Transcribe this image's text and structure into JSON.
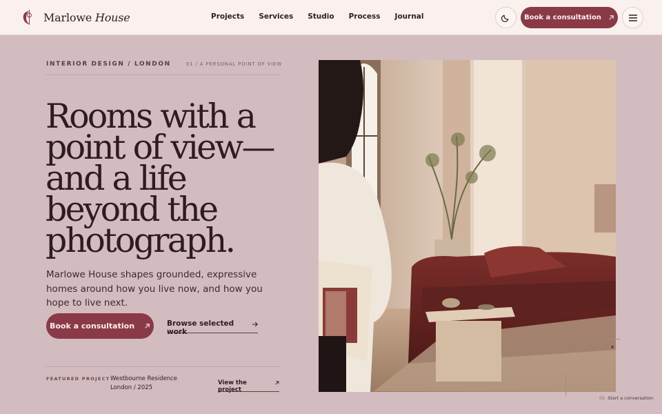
{
  "brand": {
    "name_first": "Marlowe",
    "name_second": "House"
  },
  "nav": {
    "items": [
      {
        "label": "Projects"
      },
      {
        "label": "Services"
      },
      {
        "label": "Studio"
      },
      {
        "label": "Process"
      },
      {
        "label": "Journal"
      }
    ]
  },
  "header": {
    "book_label": "Book a consultation",
    "theme_icon": "moon-icon",
    "menu_icon": "hamburger-icon"
  },
  "hero": {
    "eyebrow": "INTERIOR DESIGN / LONDON",
    "index_label": "01 / A PERSONAL POINT OF VIEW",
    "headline_lines": [
      "Rooms with a",
      "point of view—",
      "and a life",
      "beyond the",
      "photograph."
    ],
    "subtext": "Marlowe House shapes grounded, expressive homes around how you live now, and how you hope to live next.",
    "cta_primary": "Book a consultation",
    "cta_secondary": "Browse selected work"
  },
  "featured": {
    "label": "FEATURED PROJECT",
    "name": "Westbourne Residence",
    "meta": "London / 2025",
    "link": "View the project"
  },
  "footer_note": {
    "index": "05",
    "text": "Start a conversation"
  },
  "colors": {
    "background": "#d3bcc0",
    "header_bg": "#faf0ee",
    "accent": "#8a3a47",
    "text": "#2f1c1f"
  }
}
